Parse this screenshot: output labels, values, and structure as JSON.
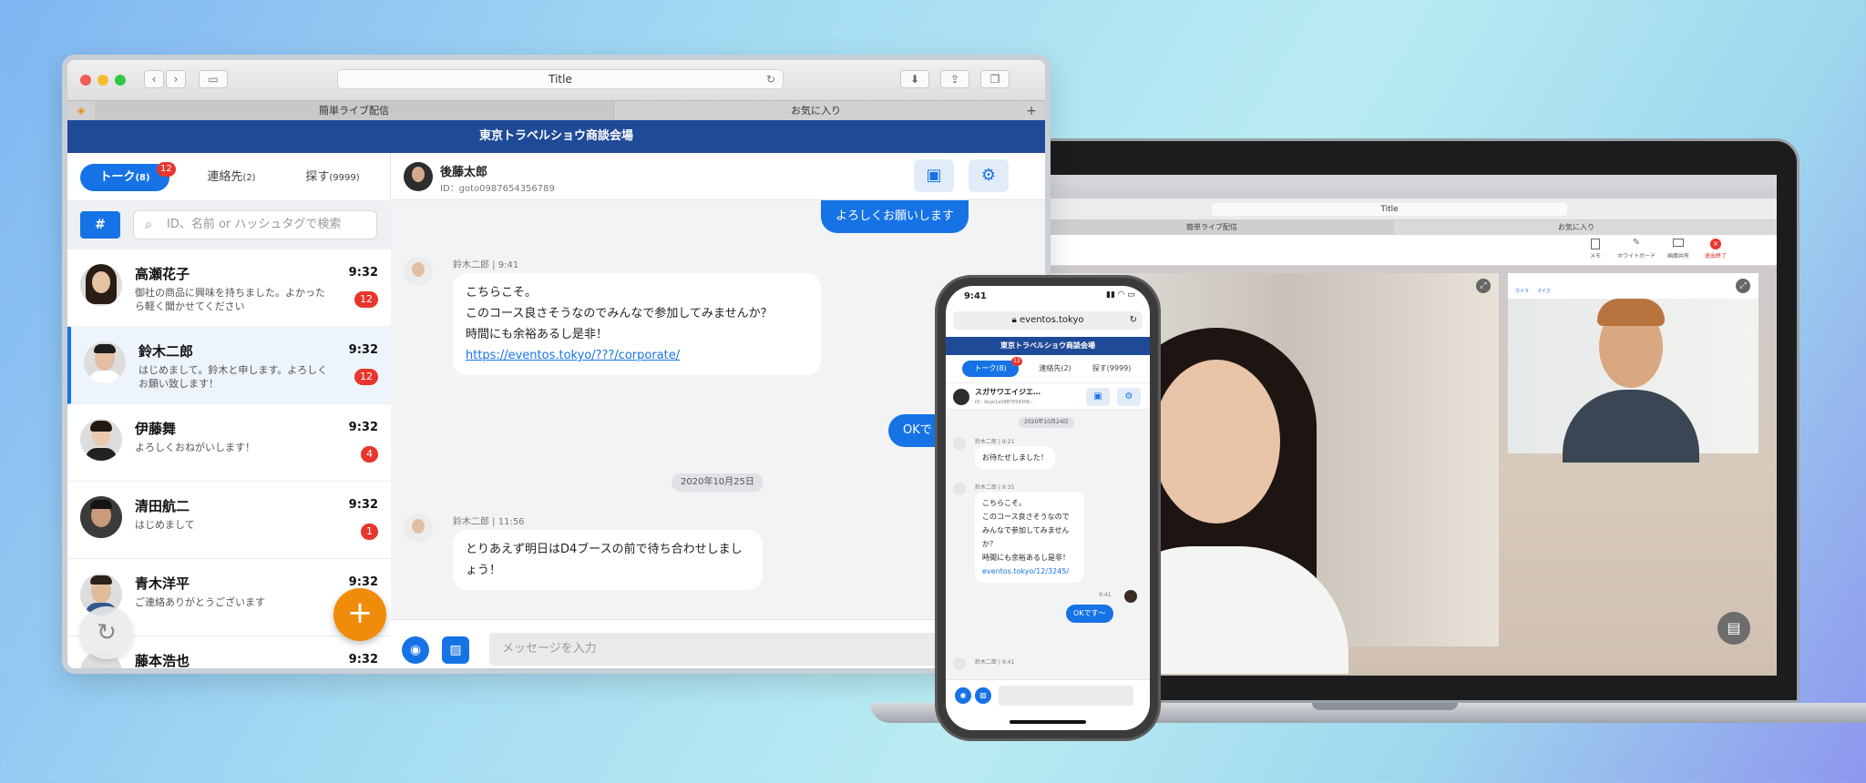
{
  "laptop": {
    "address_title": "Title",
    "tabs": [
      "簡単ライブ配信",
      "お気に入り"
    ],
    "toolbar_items": [
      "メモ",
      "ホワイトボード",
      "画面共有",
      "退出終了"
    ],
    "side_video_controls": [
      "カメラ",
      "マイク"
    ]
  },
  "browser": {
    "address_title": "Title",
    "tabs": [
      "簡単ライブ配信",
      "お気に入り"
    ],
    "new_tab": "+",
    "nav": {
      "back": "‹",
      "forward": "›"
    },
    "header_title": "東京トラベルショウ商談会場",
    "sidebar": {
      "segments": [
        {
          "label": "トーク",
          "count": "(8)",
          "badge": "12"
        },
        {
          "label": "連絡先",
          "count": "(2)"
        },
        {
          "label": "探す",
          "count": "(9999)"
        }
      ],
      "hash_label": "#",
      "search_placeholder": "ID、名前 or ハッシュタグで検索",
      "contacts": [
        {
          "name": "高瀬花子",
          "time": "9:32",
          "message": "御社の商品に興味を持ちました。よかったら軽く聞かせてください",
          "badge": "12"
        },
        {
          "name": "鈴木二郎",
          "time": "9:32",
          "message": "はじめまして。鈴木と申します。よろしくお願い致します！",
          "badge": "12"
        },
        {
          "name": "伊藤舞",
          "time": "9:32",
          "message": "よろしくおねがいします！",
          "badge": "4"
        },
        {
          "name": "清田航二",
          "time": "9:32",
          "message": "はじめまして",
          "badge": "1"
        },
        {
          "name": "青木洋平",
          "time": "9:32",
          "message": "ご連絡ありがとうございます",
          "badge": ""
        },
        {
          "name": "藤本浩也",
          "time": "9:32",
          "message": "",
          "badge": ""
        }
      ],
      "fab_label": "+",
      "refresh_label": "↻"
    },
    "chat": {
      "contact_name": "後藤太郎",
      "contact_id": "ID：goto0987654356789",
      "messages": {
        "outgoing_1": "よろしくお願いします",
        "incoming_1_sender": "鈴木二郎 | 9:41",
        "incoming_1_lines": [
          "こちらこそ。",
          "このコース良さそうなのでみんなで参加してみませんか？",
          "時間にも余裕あるし是非！"
        ],
        "incoming_1_link": "https://eventos.tokyo/???/corporate/",
        "outgoing_2": "OKで",
        "date_separator": "2020年10月25日",
        "incoming_2_sender": "鈴木二郎 | 11:56",
        "incoming_2_lines": [
          "とりあえず明日はD4ブースの前で待ち合わせしましょう！"
        ]
      },
      "input_placeholder": "メッセージを入力"
    }
  },
  "phone": {
    "time": "9:41",
    "url": "eventos.tokyo",
    "header_title": "東京トラベルショウ商談会場",
    "segments": [
      {
        "label": "トーク(8)",
        "badge": "12"
      },
      {
        "label": "連絡先(2)"
      },
      {
        "label": "探す(9999)"
      }
    ],
    "chat_name": "スガサワエイジエ…",
    "chat_id": "ID：koyo1a0987654356···",
    "date_separator": "2020年10月24日",
    "msg1_sender": "鈴木二郎 | 9:21",
    "msg1": "お待たせしました！",
    "msg2_sender": "鈴木二郎 | 9:35",
    "msg2_lines": [
      "こちらこそ。",
      "このコース良さそうなので",
      "みんなで参加してみません",
      "か？",
      "時間にも余裕あるし是非！"
    ],
    "msg2_link": "eventos.tokyo/12/3245/",
    "out_time": "9:41",
    "out_msg": "OKです～",
    "msg3_sender": "鈴木二郎 | 9:41"
  },
  "colors": {
    "primary": "#1673e6",
    "header": "#1f4a98",
    "badge": "#e8362d",
    "fab": "#f08c0a"
  }
}
